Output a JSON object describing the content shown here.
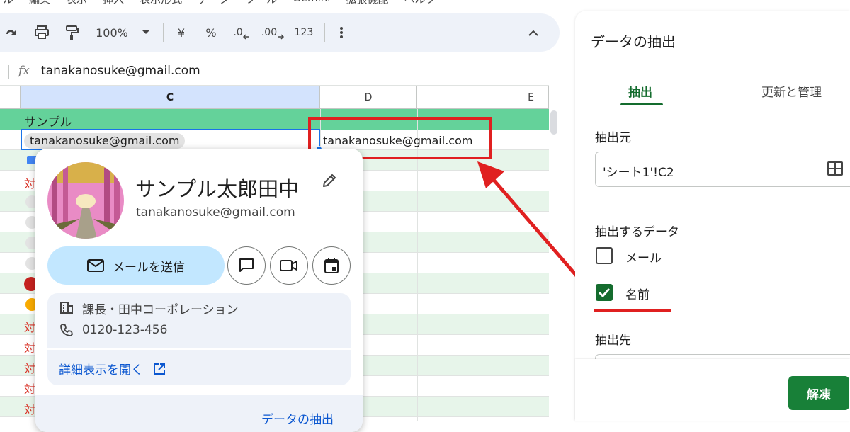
{
  "menu": {
    "items": [
      "ル",
      "編集",
      "表示",
      "挿入",
      "表示形式",
      "データ",
      "ツール",
      "Gemini",
      "拡張機能",
      "ヘルプ"
    ]
  },
  "toolbar": {
    "zoom": "100%",
    "currency": "¥",
    "percent": "%",
    "dec_decrease": ".0",
    "dec_increase": ".00",
    "format_123": "123"
  },
  "formula_bar": {
    "fx_label": "fx",
    "value": "tanakanosuke@gmail.com"
  },
  "sheet": {
    "columns": [
      "C",
      "D",
      "E"
    ],
    "header_row_text": "サンプル",
    "chip_email": "tanakanosuke@gmail.com",
    "extracted_email": "tanakanosuke@gmail.com",
    "row_prefix": "対"
  },
  "contact_card": {
    "name": "サンプル太郎田中",
    "email": "tanakanosuke@gmail.com",
    "send_mail": "メールを送信",
    "title": "課長・田中コーポレーション",
    "phone": "0120-123-456",
    "open_details": "詳細表示を開く",
    "extract_data": "データの抽出"
  },
  "panel": {
    "title": "データの抽出",
    "tab_extract": "抽出",
    "tab_manage": "更新と管理",
    "source_label": "抽出元",
    "source_value": "'シート1'!C2",
    "data_label": "抽出するデータ",
    "opt_mail": "メール",
    "opt_name": "名前",
    "dest_label": "抽出先",
    "unfreeze": "解凍"
  },
  "colors": {
    "header_green": "#64d29a",
    "row_green": "#e7f5ea",
    "accent_green": "#146c2e",
    "button_green": "#188038",
    "highlight_red": "#e02020",
    "link_blue": "#0b57d0"
  }
}
